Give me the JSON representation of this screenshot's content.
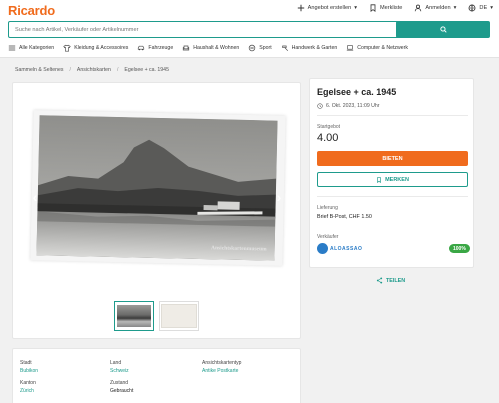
{
  "header": {
    "logo": "Ricardo",
    "sell_label": "Angebot erstellen",
    "watchlist_label": "Merkliste",
    "login_label": "Anmelden",
    "language_label": "DE",
    "search_placeholder": "Suche nach Artikel, Verkäufer oder Artikelnummer"
  },
  "categories": [
    {
      "label": "Alle Kategorien",
      "icon": "menu-icon"
    },
    {
      "label": "Kleidung & Accessoires",
      "icon": "shirt-icon"
    },
    {
      "label": "Fahrzeuge",
      "icon": "car-icon"
    },
    {
      "label": "Haushalt & Wohnen",
      "icon": "sofa-icon"
    },
    {
      "label": "Sport",
      "icon": "ball-icon"
    },
    {
      "label": "Handwerk & Garten",
      "icon": "hammer-icon"
    },
    {
      "label": "Computer & Netzwerk",
      "icon": "laptop-icon"
    }
  ],
  "breadcrumb": [
    "Sammeln & Seltenes",
    "Ansichtskarten",
    "Egelsee + ca. 1945"
  ],
  "gallery": {
    "watermark": "Ansichtskartenmuseum"
  },
  "listing": {
    "title": "Egelsee + ca. 1945",
    "end_date": "6. Okt. 2023, 11:09 Uhr",
    "start_bid_label": "Startgebot",
    "price": "4.00",
    "bid_button": "BIETEN",
    "watch_button": "MERKEN",
    "delivery_label": "Lieferung",
    "delivery_value": "Brief B-Post, CHF 1.50",
    "seller_label": "Verkäufer",
    "seller_name": "ALOASSAO",
    "rating": "100%",
    "share_label": "TEILEN"
  },
  "details": {
    "city_label": "Stadt",
    "city": "Bubikon",
    "country_label": "Land",
    "country": "Schweiz",
    "type_label": "Ansichtskartentyp",
    "type": "Antike Postkarte",
    "canton_label": "Kanton",
    "canton": "Zürich",
    "condition_label": "Zustand",
    "condition": "Gebraucht"
  },
  "colors": {
    "brand_orange": "#f06b1d",
    "accent_teal": "#1e9b8c",
    "rating_green": "#3aa745"
  }
}
